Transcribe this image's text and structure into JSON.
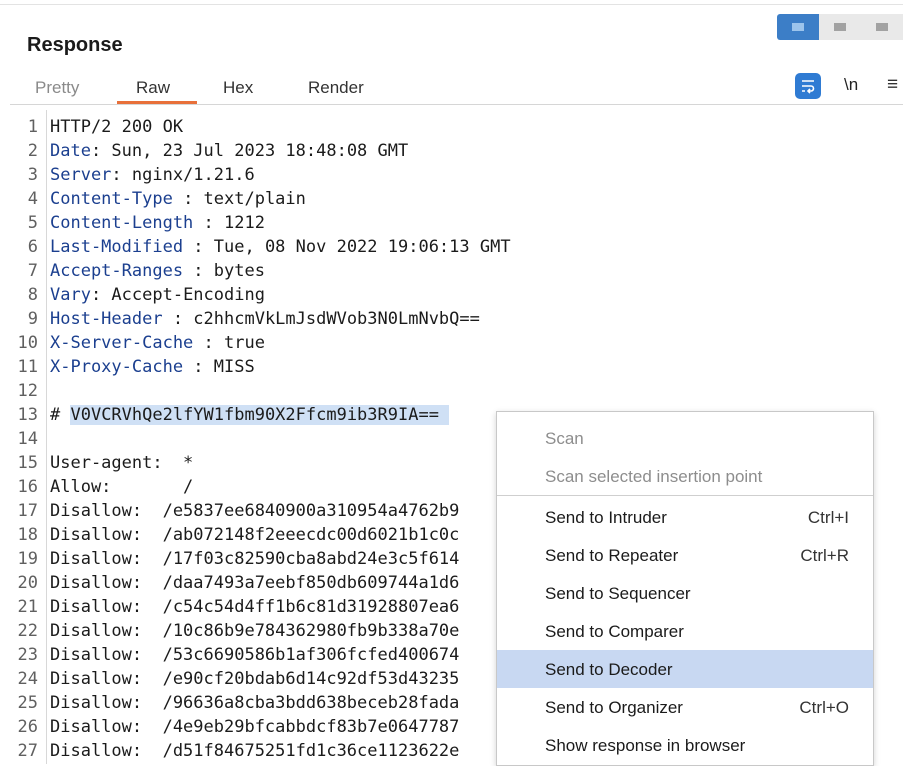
{
  "panel": {
    "title": "Response"
  },
  "tabs": [
    {
      "label": "Pretty",
      "state": "muted"
    },
    {
      "label": "Raw",
      "state": "active"
    },
    {
      "label": "Hex",
      "state": "normal"
    },
    {
      "label": "Render",
      "state": "normal"
    }
  ],
  "toolbar": {
    "wrap_icon": "word-wrap-icon",
    "newline_label": "\\n",
    "menu_glyph": "≡"
  },
  "lines": [
    {
      "n": "1",
      "key": "",
      "text": "HTTP/2 200 OK"
    },
    {
      "n": "2",
      "key": "Date",
      "text": ": Sun, 23 Jul 2023 18:48:08 GMT"
    },
    {
      "n": "3",
      "key": "Server",
      "text": ": nginx/1.21.6"
    },
    {
      "n": "4",
      "key": "Content-Type",
      "text": " : text/plain"
    },
    {
      "n": "5",
      "key": "Content-Length",
      "text": " : 1212"
    },
    {
      "n": "6",
      "key": "Last-Modified",
      "text": " : Tue, 08 Nov 2022 19:06:13 GMT"
    },
    {
      "n": "7",
      "key": "Accept-Ranges",
      "text": " : bytes"
    },
    {
      "n": "8",
      "key": "Vary",
      "text": ": Accept-Encoding"
    },
    {
      "n": "9",
      "key": "Host-Header",
      "text": " : c2hhcmVkLmJsdWVob3N0LmNvbQ=="
    },
    {
      "n": "10",
      "key": "X-Server-Cache",
      "text": " : true"
    },
    {
      "n": "11",
      "key": "X-Proxy-Cache",
      "text": " : MISS"
    },
    {
      "n": "12",
      "key": "",
      "text": ""
    },
    {
      "n": "13",
      "key": "",
      "text": "# V0VCRVhQe2lfYW1fbm90X2Ffcm9ib3R9IA== "
    },
    {
      "n": "14",
      "key": "",
      "text": ""
    },
    {
      "n": "15",
      "key": "",
      "text": "User-agent:  *"
    },
    {
      "n": "16",
      "key": "",
      "text": "Allow:       /"
    },
    {
      "n": "17",
      "key": "",
      "text": "Disallow:  /e5837ee6840900a310954a4762b9"
    },
    {
      "n": "18",
      "key": "",
      "text": "Disallow:  /ab072148f2eeecdc00d6021b1c0c"
    },
    {
      "n": "19",
      "key": "",
      "text": "Disallow:  /17f03c82590cba8abd24e3c5f614"
    },
    {
      "n": "20",
      "key": "",
      "text": "Disallow:  /daa7493a7eebf850db609744a1d6"
    },
    {
      "n": "21",
      "key": "",
      "text": "Disallow:  /c54c54d4ff1b6c81d31928807ea6"
    },
    {
      "n": "22",
      "key": "",
      "text": "Disallow:  /10c86b9e784362980fb9b338a70e"
    },
    {
      "n": "23",
      "key": "",
      "text": "Disallow:  /53c6690586b1af306fcfed400674"
    },
    {
      "n": "24",
      "key": "",
      "text": "Disallow:  /e90cf20bdab6d14c92df53d43235"
    },
    {
      "n": "25",
      "key": "",
      "text": "Disallow:  /96636a8cba3bdd638beceb28fada"
    },
    {
      "n": "26",
      "key": "",
      "text": "Disallow:  /4e9eb29bfcabbdcf83b7e0647787"
    },
    {
      "n": "27",
      "key": "",
      "text": "Disallow:  /d51f84675251fd1c36ce1123622e"
    }
  ],
  "context_menu": {
    "items": [
      {
        "label": "Scan",
        "shortcut": "",
        "disabled": true,
        "active": false
      },
      {
        "label": "Scan selected insertion point",
        "shortcut": "",
        "disabled": true,
        "active": false
      },
      {
        "label": "Send to Intruder",
        "shortcut": "Ctrl+I",
        "disabled": false,
        "active": false
      },
      {
        "label": "Send to Repeater",
        "shortcut": "Ctrl+R",
        "disabled": false,
        "active": false
      },
      {
        "label": "Send to Sequencer",
        "shortcut": "",
        "disabled": false,
        "active": false
      },
      {
        "label": "Send to Comparer",
        "shortcut": "",
        "disabled": false,
        "active": false
      },
      {
        "label": "Send to Decoder",
        "shortcut": "",
        "disabled": false,
        "active": true
      },
      {
        "label": "Send to Organizer",
        "shortcut": "Ctrl+O",
        "disabled": false,
        "active": false
      },
      {
        "label": "Show response in browser",
        "shortcut": "",
        "disabled": false,
        "active": false
      }
    ]
  },
  "colors": {
    "accent": "#e8703a",
    "key": "#1b3f8f",
    "selection": "#cfe0f5",
    "menu_active": "#c8d8f2",
    "toggle_active": "#3c7ec7"
  }
}
